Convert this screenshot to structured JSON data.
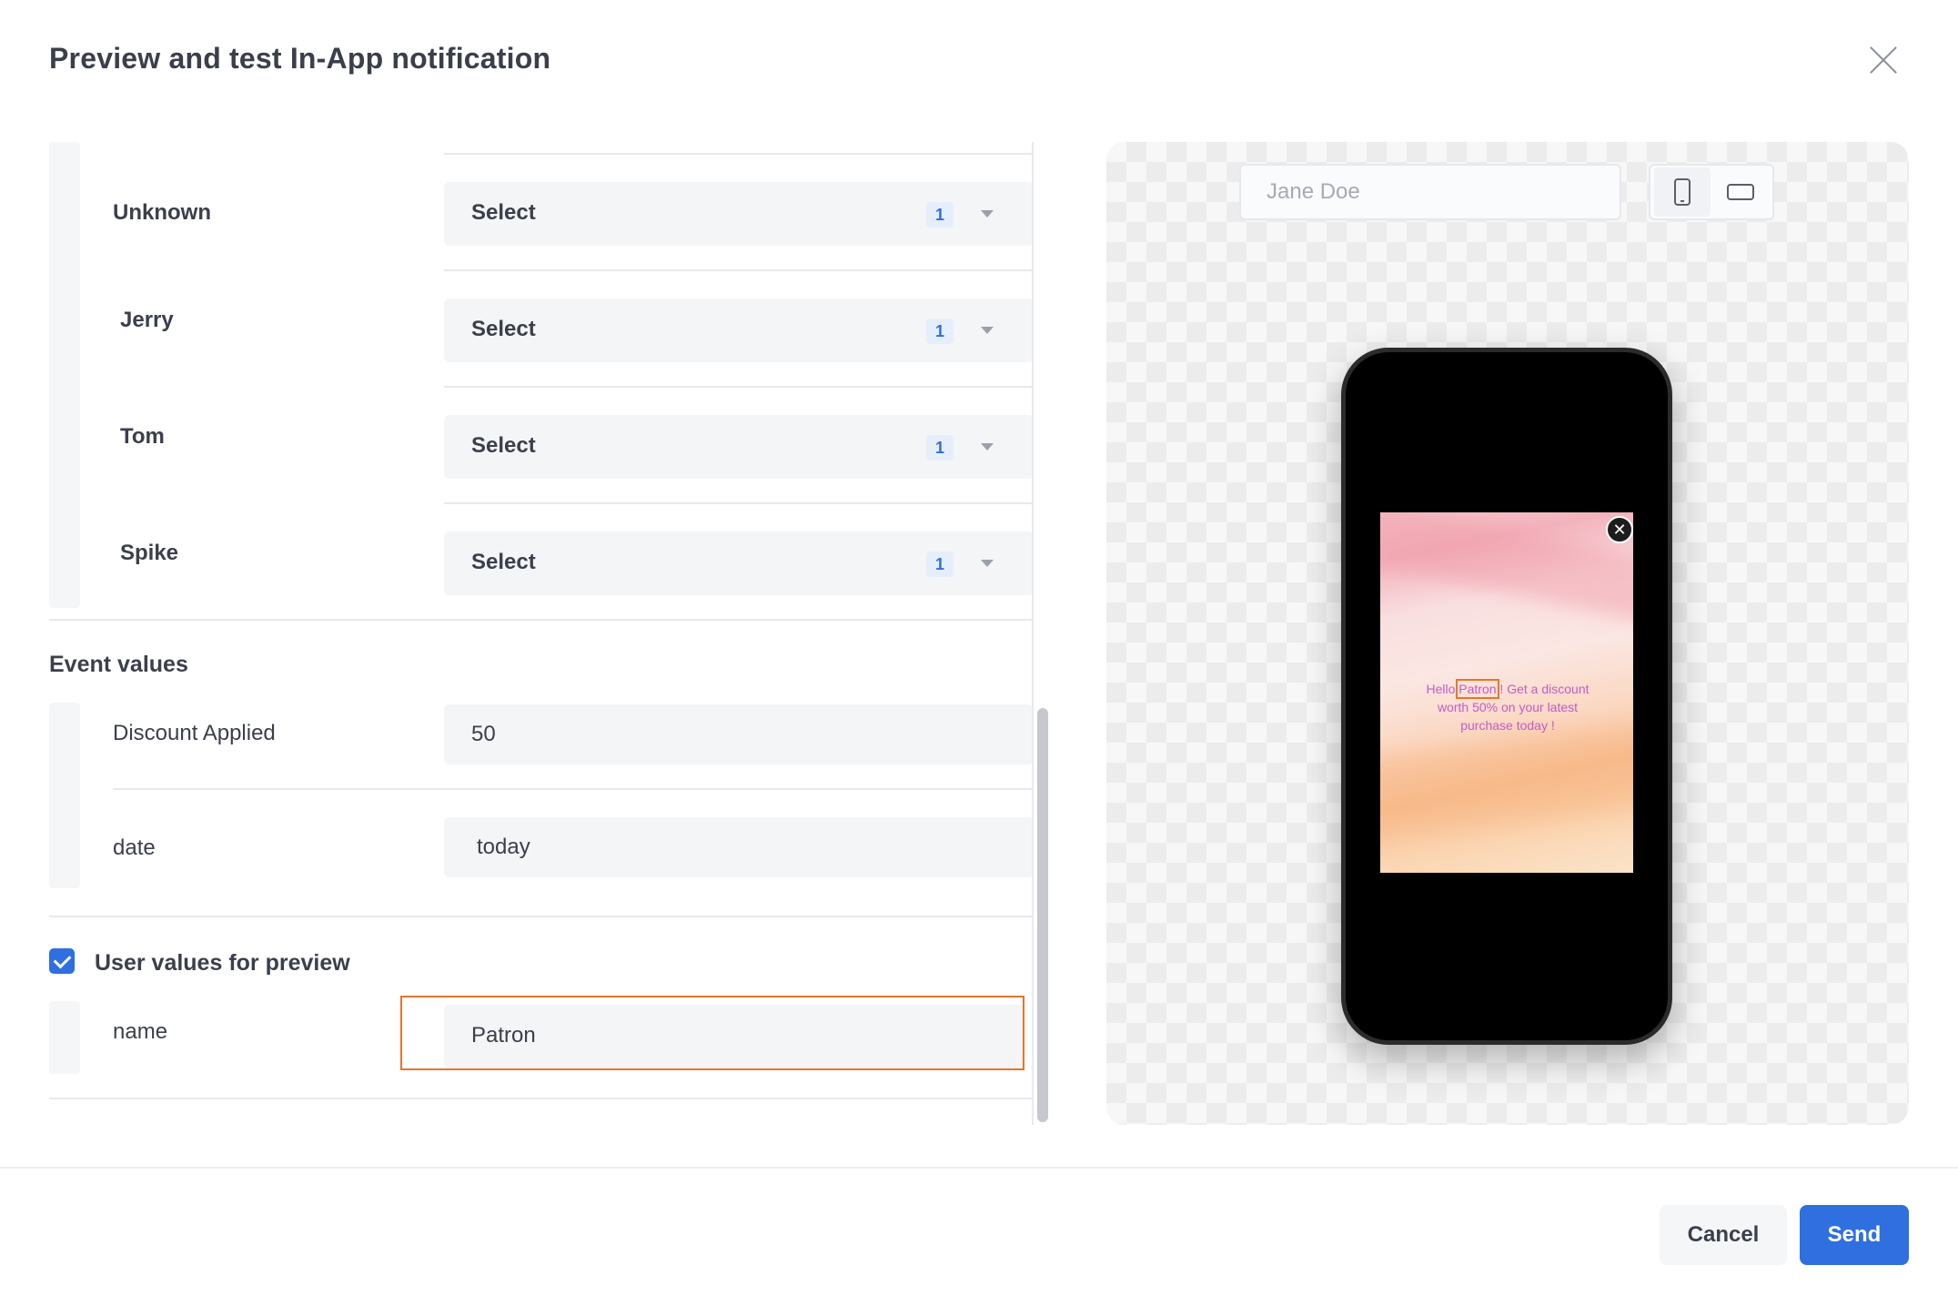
{
  "modal": {
    "title": "Preview and test In-App notification"
  },
  "variants": [
    {
      "label": "Unknown",
      "select_label": "Select",
      "count": "1"
    },
    {
      "label": "Jerry",
      "select_label": "Select",
      "count": "1"
    },
    {
      "label": "Tom",
      "select_label": "Select",
      "count": "1"
    },
    {
      "label": "Spike",
      "select_label": "Select",
      "count": "1"
    }
  ],
  "event_values": {
    "title": "Event values",
    "rows": [
      {
        "label": "Discount Applied",
        "value": "50"
      },
      {
        "label": "date",
        "value": "today"
      }
    ]
  },
  "user_values": {
    "checkbox_label": "User values for preview",
    "checked": true,
    "rows": [
      {
        "label": "name",
        "value": "Patron"
      }
    ]
  },
  "preview": {
    "user_placeholder": "Jane Doe",
    "device_selected": "phone",
    "notification": {
      "text_before": "Hello ",
      "name": "Patron",
      "text_after": " ! Get a discount worth 50% on your latest purchase today !",
      "close_glyph": "✕"
    }
  },
  "footer": {
    "cancel_label": "Cancel",
    "send_label": "Send"
  },
  "colors": {
    "accent": "#2f6fe0",
    "highlight": "#e8742c",
    "notification_text": "#c25cc7"
  }
}
